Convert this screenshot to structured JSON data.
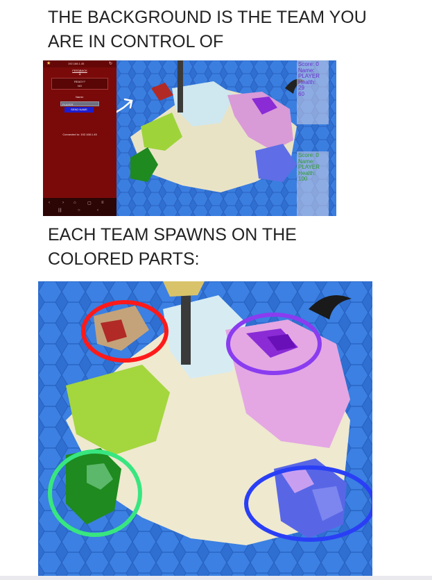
{
  "headings": {
    "line1": "THE BACKGROUND IS THE TEAM YOU",
    "line2": "ARE IN CONTROL OF",
    "line3": "EACH TEAM SPAWNS ON THE",
    "line4": "COLORED PARTS:"
  },
  "phone": {
    "status_ip": "192.168.1.45",
    "feedback_label": "FEEDBACK",
    "feedback_value": "1",
    "ready_label": "READY?",
    "ready_value": "NO",
    "name_label": "Name:",
    "name_input_value": "PLAYER",
    "send_button": "SEND NAME",
    "connected_text": "Connected to: 192.168.1.45",
    "background_color": "#7a0a0a"
  },
  "hud_panels": [
    {
      "score_label": "Score: 0",
      "name_label": "Name:",
      "name_value": "PLAYER",
      "health_label": "Health:",
      "health_values": [
        "29",
        "60"
      ],
      "text_color": "#6633cc"
    },
    {
      "score_label": "Score: 0",
      "name_label": "Name:",
      "name_value": "PLAYER",
      "health_label": "Health:",
      "health_values": [
        "100"
      ],
      "text_color": "#2f9a2f"
    }
  ],
  "team_colors": {
    "red": "#b12a25",
    "purple": "#8a2bd6",
    "light_green": "#9ed43a",
    "dark_green": "#1f8a1f",
    "blue": "#4c5ae0",
    "sand": "#efe9cf"
  },
  "circle_colors": {
    "red": "#ff1a1a",
    "purple": "#8a3cf0",
    "green": "#38e680",
    "blue": "#2a3ff5"
  },
  "icons": [
    "arrow-icon",
    "star-icon",
    "rotate-icon"
  ]
}
